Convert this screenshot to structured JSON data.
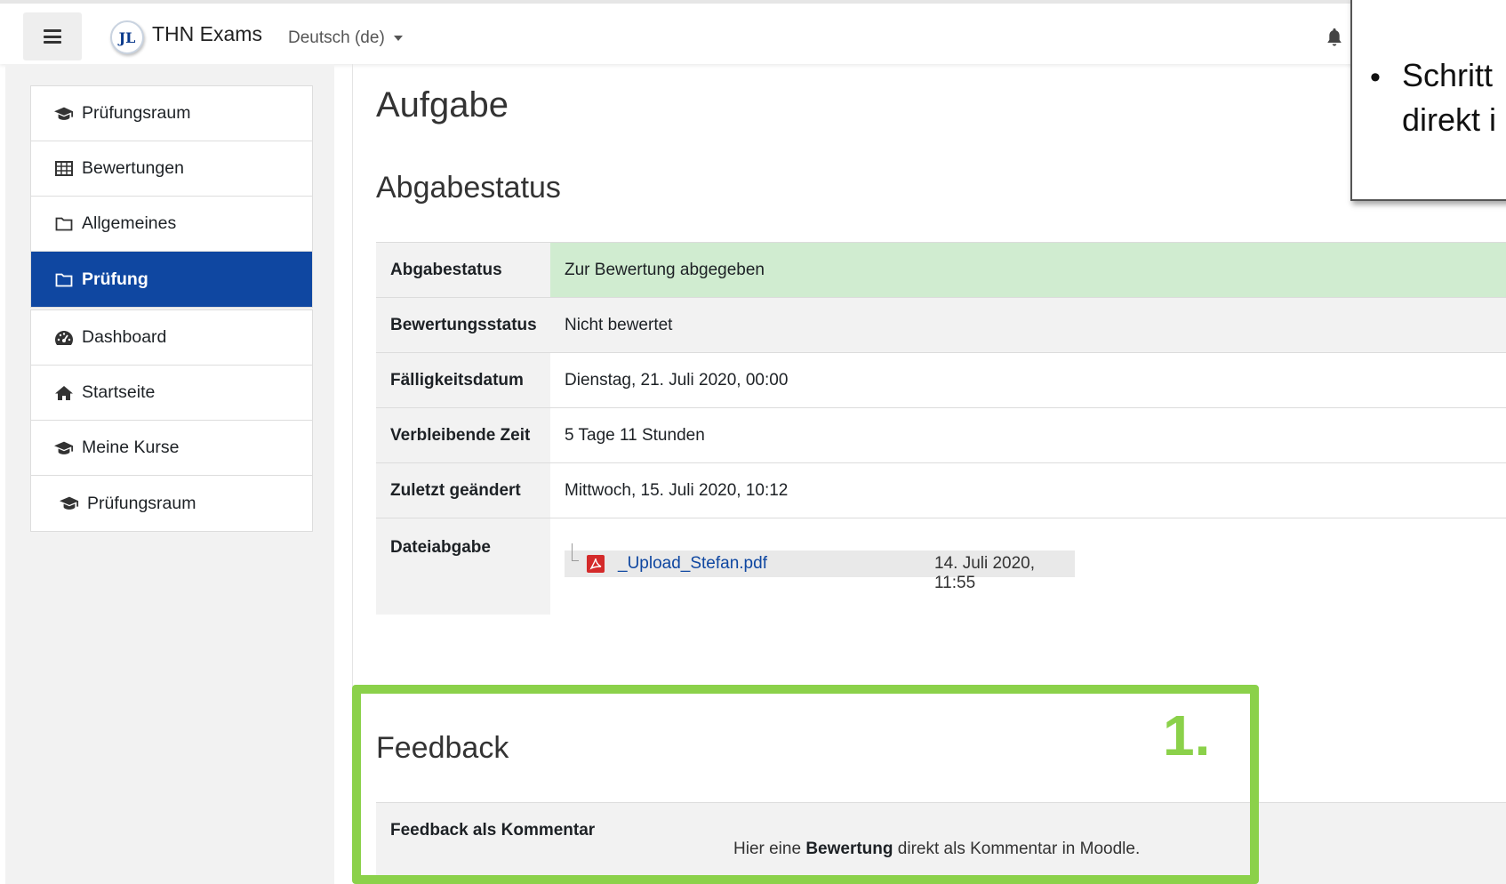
{
  "navbar": {
    "brand": "THN Exams",
    "language": "Deutsch (de)",
    "logo_text": "JL"
  },
  "sidebar": {
    "group1": [
      {
        "label": "Prüfungsraum",
        "icon": "graduation-cap-icon"
      },
      {
        "label": "Bewertungen",
        "icon": "table-icon"
      },
      {
        "label": "Allgemeines",
        "icon": "folder-icon"
      },
      {
        "label": "Prüfung",
        "icon": "folder-icon",
        "active": true
      }
    ],
    "group2": [
      {
        "label": "Dashboard",
        "icon": "dashboard-icon"
      },
      {
        "label": "Startseite",
        "icon": "home-icon"
      },
      {
        "label": "Meine Kurse",
        "icon": "graduation-cap-icon"
      },
      {
        "label": "Prüfungsraum",
        "icon": "graduation-cap-icon"
      }
    ],
    "active_color": "#0f47a1"
  },
  "main": {
    "title": "Aufgabe",
    "status_heading": "Abgabestatus",
    "status_rows": [
      {
        "label": "Abgabestatus",
        "value": "Zur Bewertung abgegeben"
      },
      {
        "label": "Bewertungsstatus",
        "value": "Nicht bewertet"
      },
      {
        "label": "Fälligkeitsdatum",
        "value": "Dienstag, 21. Juli 2020, 00:00"
      },
      {
        "label": "Verbleibende Zeit",
        "value": "5 Tage 11 Stunden"
      },
      {
        "label": "Zuletzt geändert",
        "value": "Mittwoch, 15. Juli 2020, 10:12"
      },
      {
        "label": "Dateiabgabe",
        "value": ""
      }
    ],
    "file": {
      "name": "_Upload_Stefan.pdf",
      "date": "14. Juli 2020, 11:55",
      "icon": "pdf-icon"
    },
    "feedback": {
      "heading": "Feedback",
      "row_label": "Feedback als Kommentar",
      "text_before": "Hier eine ",
      "text_bold": "Bewertung",
      "text_after": " direkt als Kommentar in Moodle."
    },
    "submitted_color": "#d0ecd0"
  },
  "annotation": {
    "step_number": "1.",
    "highlight_color": "#8bd14a",
    "callout_bullet": "•",
    "callout_line1": "Schritt",
    "callout_line2": "direkt i"
  }
}
